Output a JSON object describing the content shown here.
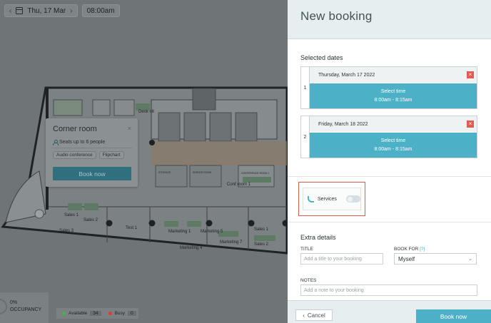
{
  "topbar": {
    "date_label": "Thu, 17 Mar",
    "time_label": "08:00am",
    "prev_arrow": "‹",
    "next_arrow": "›"
  },
  "popup": {
    "title": "Corner room",
    "close": "×",
    "seats": "Seats up to 6 people",
    "tags": [
      "Audio conference",
      "Flipchart"
    ],
    "book_label": "Book now"
  },
  "rooms": {
    "desk": "Desk #8",
    "conf_room_1": "Conf room 1",
    "conference_room": "CONFERENCE ROOM 1",
    "storage": "STORAGE",
    "server_room": "SERVER ROOM",
    "sales_1a": "Sales 1",
    "sales_2a": "Sales 2",
    "sales_3": "Sales 3",
    "test_1": "Test 1",
    "marketing_1": "Marketing 1",
    "marketing_5": "Marketing 5",
    "marketing_4": "Marketing 4",
    "marketing_7": "Marketing 7",
    "sales_1b": "Sales 1",
    "sales_2b": "Sales 2"
  },
  "occupancy": {
    "percent": "0%",
    "label": "OCCUPANCY"
  },
  "legend": {
    "available_label": "Available",
    "available_count": "34",
    "busy_label": "Busy",
    "busy_count": "0",
    "available_color": "#4caf50",
    "busy_color": "#e53935"
  },
  "panel": {
    "title": "New booking",
    "selected_dates_title": "Selected dates",
    "dates": [
      {
        "index": "1",
        "date": "Thursday, March 17 2022",
        "select_label": "Select time",
        "time_range": "8:00am - 8:15am",
        "remove": "×"
      },
      {
        "index": "2",
        "date": "Friday, March 18 2022",
        "select_label": "Select time",
        "time_range": "8:00am - 8:15am",
        "remove": "×"
      }
    ],
    "services_label": "Services",
    "extra_details_title": "Extra details",
    "title_label": "TITLE",
    "title_placeholder": "Add a title to your booking",
    "book_for_label": "BOOK FOR",
    "book_for_help": "[?]",
    "book_for_value": "Myself",
    "notes_label": "NOTES",
    "notes_placeholder": "Add a note to your booking",
    "cancel_label": "Cancel",
    "cancel_arrow": "‹",
    "book_label": "Book now"
  },
  "colors": {
    "accent": "#4cb1c7",
    "danger": "#e35a4f",
    "overlay": "#6f7476"
  }
}
